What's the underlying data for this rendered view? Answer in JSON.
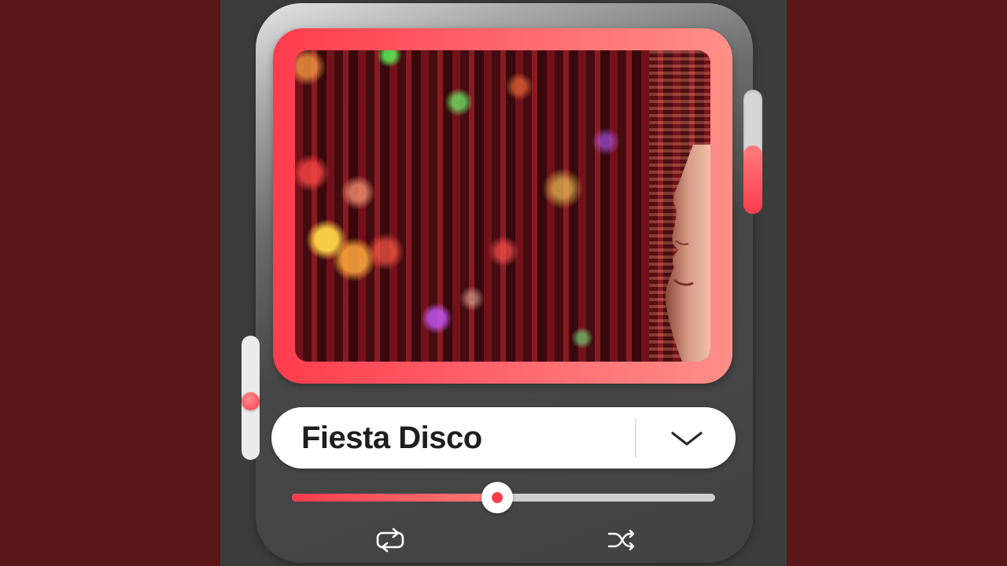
{
  "track": {
    "title": "Fiesta Disco"
  },
  "progress": {
    "fraction": 0.486
  },
  "volume": {
    "fraction": 0.55
  },
  "left_slider": {
    "fraction": 0.47
  },
  "controls": {
    "dropdown_icon": "chevron-down-icon",
    "repeat_icon": "repeat-icon",
    "shuffle_icon": "shuffle-icon"
  },
  "colors": {
    "background": "#5a1616",
    "panel": "#3c3c3c",
    "accent": "#ff3c4e",
    "accent_light": "#ff7a78"
  }
}
